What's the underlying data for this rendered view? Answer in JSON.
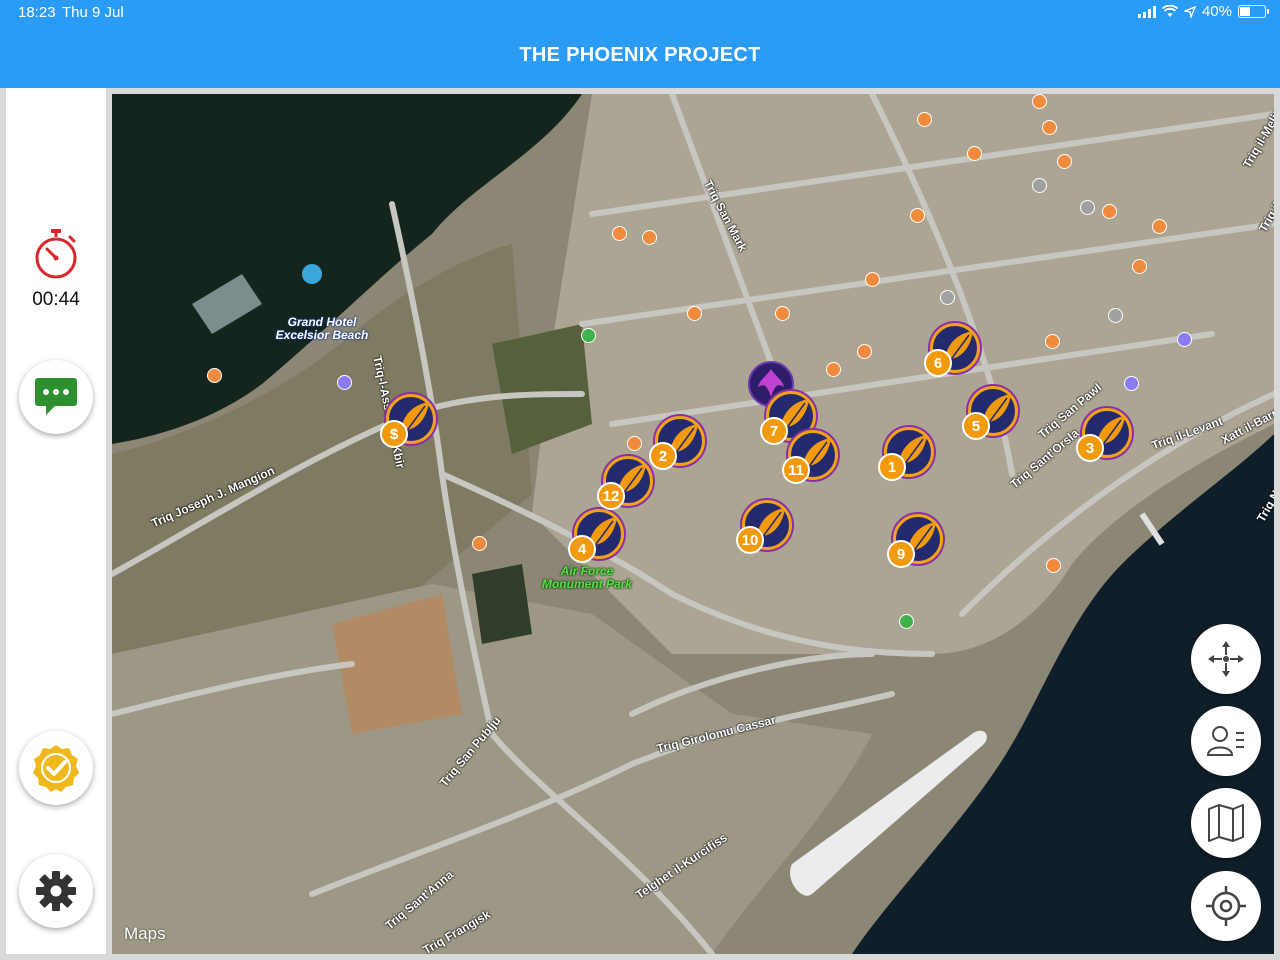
{
  "status_bar": {
    "time": "18:23",
    "date": "Thu 9 Jul",
    "battery": "40%",
    "battery_level": 0.4
  },
  "header": {
    "title": "THE PHOENIX PROJECT"
  },
  "sidebar": {
    "timer_icon": "stopwatch-icon",
    "timer": "00:44",
    "chat_icon": "chat-bubble-icon",
    "badge_icon": "checkmark-badge-icon",
    "settings_icon": "gear-icon"
  },
  "map": {
    "credit": "Maps",
    "streets": [
      "Triq Joseph J. Mangion",
      "Triq-l-Assedju l-Kbir",
      "Triq San Mark",
      "Triq San Pawl",
      "Triq Sant'Orsla",
      "Triq il-Levant",
      "Xatt il-Barriera",
      "Triq Girolomu Cassar",
      "Triq San Publju",
      "Triq Sant'Anna",
      "Telghet il-Kurcifiss",
      "Triq il-Melita",
      "Triq il-Pitkali",
      "Triq Nofsinhar",
      "Triq Frangisk"
    ],
    "poi_labels": [
      "Grand Hotel Excelsior Beach",
      "Air Force Monument Park"
    ],
    "markers": [
      "1",
      "2",
      "3",
      "4",
      "5",
      "6",
      "7",
      "9",
      "10",
      "11",
      "12"
    ],
    "accent_color": "#f29a0e",
    "marker_color": "#232a6e"
  },
  "controls": {
    "recenter_icon": "compass-arrows-icon",
    "players_icon": "player-list-icon",
    "map_icon": "folded-map-icon",
    "locate_icon": "crosshair-icon"
  },
  "colors": {
    "header": "#2a9cf5",
    "timer_red": "#d8262c",
    "chat_green": "#2e8f2f",
    "badge_gold": "#f0b81c"
  }
}
